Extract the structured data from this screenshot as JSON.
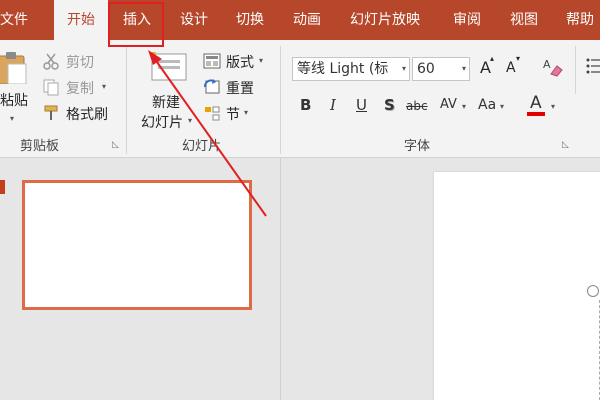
{
  "tabs": [
    {
      "label": "文件"
    },
    {
      "label": "开始"
    },
    {
      "label": "插入"
    },
    {
      "label": "设计"
    },
    {
      "label": "切换"
    },
    {
      "label": "动画"
    },
    {
      "label": "幻灯片放映"
    },
    {
      "label": "审阅"
    },
    {
      "label": "视图"
    },
    {
      "label": "帮助"
    }
  ],
  "clipboard": {
    "paste": "粘贴",
    "cut": "剪切",
    "copy": "复制",
    "format_painter": "格式刷",
    "title": "剪贴板"
  },
  "slides": {
    "new_slide_line1": "新建",
    "new_slide_line2": "幻灯片",
    "layout": "版式",
    "reset": "重置",
    "section": "节",
    "title": "幻灯片"
  },
  "font": {
    "name": "等线 Light (标",
    "size": "60",
    "grow": "A",
    "shrink": "A",
    "bold": "B",
    "italic": "I",
    "underline": "U",
    "shadow": "S",
    "strike": "abc",
    "spacing": "AV",
    "case": "Aa",
    "color": "A",
    "title": "字体"
  },
  "colors": {
    "accent": "#b7472a",
    "highlight_box": "#e02020",
    "thumb_border": "#e06a47",
    "font_color_bar": "#e00000"
  },
  "icons": {
    "paste": "clipboard-icon",
    "cut": "scissors-icon",
    "copy": "copy-icon",
    "format_painter": "paintbrush-icon",
    "new_slide": "new-slide-icon",
    "layout": "layout-icon",
    "reset": "reset-icon",
    "section": "section-icon",
    "clear_format": "eraser-icon",
    "arrow": "annotation-arrow-icon"
  }
}
